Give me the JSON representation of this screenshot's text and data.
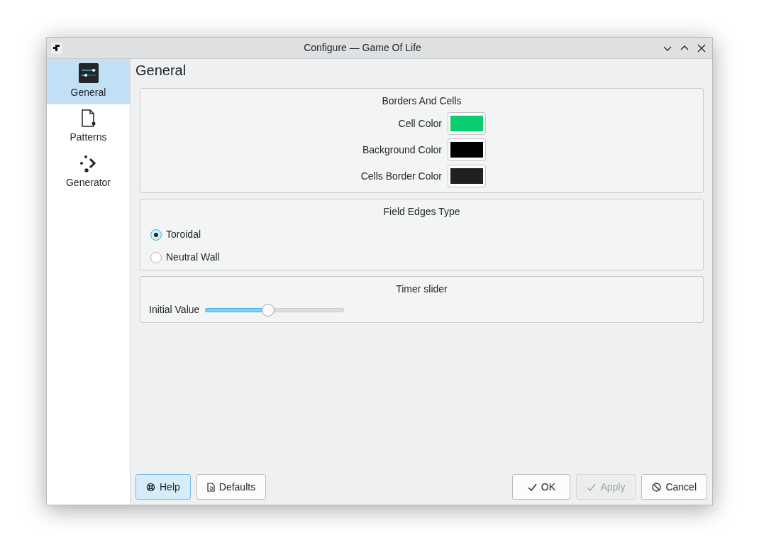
{
  "window": {
    "title": "Configure — Game Of Life"
  },
  "sidebar": {
    "items": [
      {
        "label": "General",
        "kind": "sliders",
        "selected": true
      },
      {
        "label": "Patterns",
        "kind": "document",
        "selected": false
      },
      {
        "label": "Generator",
        "kind": "generator",
        "selected": false
      }
    ]
  },
  "page_title": "General",
  "groups": [
    {
      "kind": "colors",
      "title": "Borders And Cells",
      "rows": [
        {
          "label": "Cell Color",
          "color": "#0ace6e"
        },
        {
          "label": "Background Color",
          "color": "#000000"
        },
        {
          "label": "Cells Border Color",
          "color": "#202020"
        }
      ]
    },
    {
      "kind": "radios",
      "title": "Field Edges Type",
      "options": [
        {
          "label": "Toroidal",
          "selected": true
        },
        {
          "label": "Neutral Wall",
          "selected": false
        }
      ]
    },
    {
      "kind": "slider",
      "title": "Timer slider",
      "label": "Initial Value",
      "level": 0.45
    }
  ],
  "buttons": [
    {
      "label": "Help",
      "kind": "help",
      "disabled": false,
      "selected": true
    },
    {
      "label": "Defaults",
      "kind": "defaults",
      "disabled": false,
      "selected": false
    },
    {
      "label": "OK",
      "kind": "check",
      "disabled": false,
      "selected": false
    },
    {
      "label": "Apply",
      "kind": "check",
      "disabled": true,
      "selected": false
    },
    {
      "label": "Cancel",
      "kind": "cancel",
      "disabled": false,
      "selected": false
    }
  ]
}
